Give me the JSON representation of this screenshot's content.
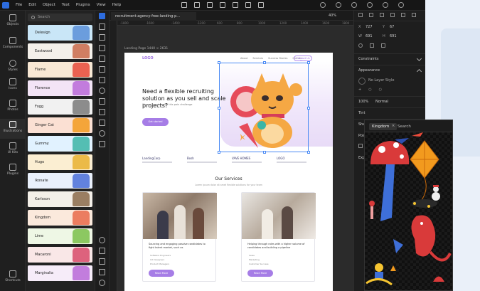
{
  "menu": [
    "File",
    "Edit",
    "Object",
    "Text",
    "Plugins",
    "View",
    "Help"
  ],
  "nav": [
    {
      "label": "Objects"
    },
    {
      "label": "Components"
    },
    {
      "label": "Styles"
    },
    {
      "label": "Icons"
    },
    {
      "label": "Photos"
    },
    {
      "label": "Illustrations",
      "active": true
    },
    {
      "label": "UI Kits"
    },
    {
      "label": "Plugins"
    }
  ],
  "nav_bottom": "Shortcuts",
  "assets": {
    "search_placeholder": "Search",
    "packs": [
      {
        "name": "Delesign",
        "color": "#c9e6f7"
      },
      {
        "name": "Eastwood",
        "color": "#f4f0ea"
      },
      {
        "name": "Flame",
        "color": "#f8e8d4"
      },
      {
        "name": "Florence",
        "color": "#f3e4f6"
      },
      {
        "name": "Fogg",
        "color": "#f1f1f1"
      },
      {
        "name": "Ginger Cat",
        "color": "#fbe0d3"
      },
      {
        "name": "Gummy",
        "color": "#e1f2ff"
      },
      {
        "name": "Hugo",
        "color": "#fbeed2"
      },
      {
        "name": "Ikonate",
        "color": "#e9f0fb"
      },
      {
        "name": "Karlsson",
        "color": "#f3efe8"
      },
      {
        "name": "Kingdom",
        "color": "#fbe9dc"
      },
      {
        "name": "Lime",
        "color": "#eef7e5"
      },
      {
        "name": "Macaroni",
        "color": "#f9e7e7"
      },
      {
        "name": "Marginalia",
        "color": "#f6ecf9"
      }
    ]
  },
  "tab": "recruitment-agency-free-landing-p...",
  "zoom": "40%",
  "ruler": [
    "-1800",
    "-1600",
    "-1400",
    "-1200",
    "600",
    "800",
    "1000",
    "1200",
    "1400",
    "1600",
    "1800"
  ],
  "board_label": "Landing Page 1440 × 2631",
  "landing": {
    "logo": "LOGO",
    "nav": [
      "About",
      "Services",
      "Success Stories",
      "Hire Us"
    ],
    "cta": "Contact Us Now",
    "headline": "Need a flexible recruiting solution as you sell and scale projects?",
    "subline": "We are here to solve this pain challenge",
    "button": "Get started",
    "logos": [
      "LandingCorp",
      "Bosh",
      "VAVE HOMES",
      "LOGO"
    ],
    "services_title": "Our Services",
    "services_sub": "Lorem ipsum dolor sit amet flexible solutions for your team",
    "cards": [
      {
        "text": "Sourcing and engaging passive candidates to fight talent market, such as",
        "items": [
          "Software Engineers",
          "UX Designers",
          "Product Managers"
        ],
        "button": "Read More"
      },
      {
        "text": "Helping through roles with a higher volume of candidates and building a pipeline",
        "items": [
          "Sales",
          "Marketing",
          "Customer Success"
        ],
        "button": "Read More"
      }
    ]
  },
  "inspector": {
    "x": "727",
    "y": "67",
    "w": "691",
    "h": "691",
    "constraints": "Constraints",
    "appearance": "Appearance",
    "layer_style": "No Layer Style",
    "opacity": "100%",
    "blend": "Normal",
    "tint": "Tint",
    "shadow": "Shad",
    "export": "Expo",
    "point": "Poin"
  },
  "popup": {
    "chip": "Kingdom",
    "close": "×",
    "search": "Search"
  },
  "colors": {
    "accent": "#2d6cdf",
    "brand_purple": "#a67de6"
  }
}
